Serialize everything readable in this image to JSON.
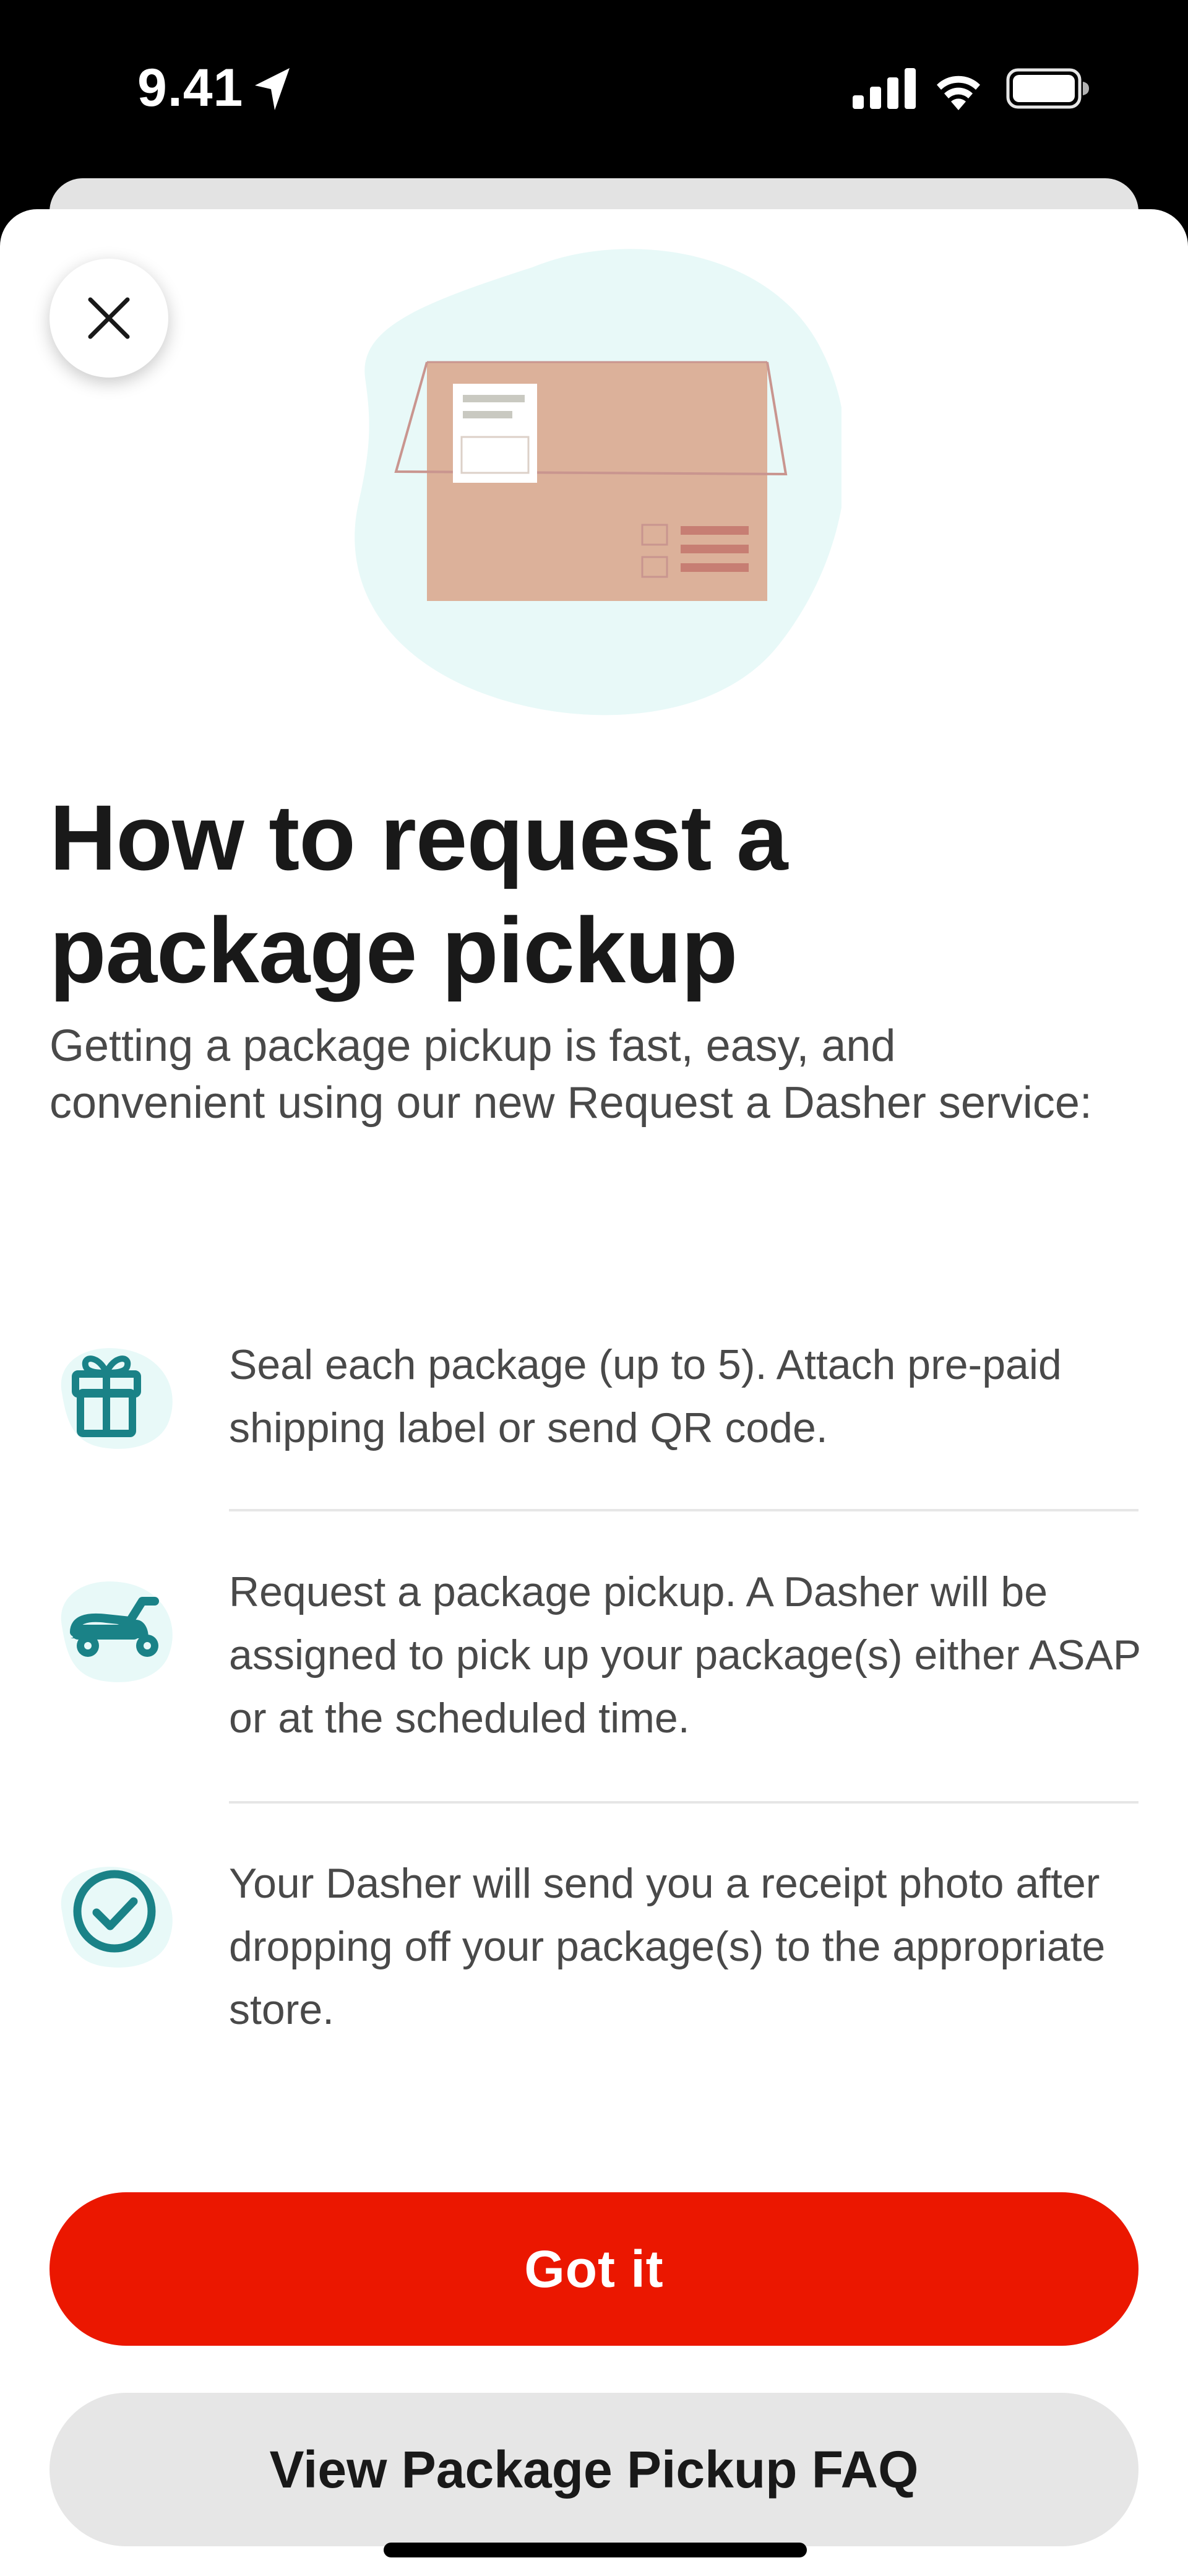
{
  "status_bar": {
    "time": "9.41",
    "icons": [
      "location-arrow-icon",
      "cellular-signal-icon",
      "wifi-icon",
      "battery-icon"
    ]
  },
  "modal": {
    "close_icon": "close-icon",
    "hero_illustration": "package-box-illustration",
    "title": "How to request a package pickup",
    "subtitle": "Getting a package pickup is fast, easy, and convenient using our new Request a Dasher service:",
    "steps": [
      {
        "icon": "gift-icon",
        "text": "Seal each package (up to 5). Attach pre-paid shipping label or send QR code."
      },
      {
        "icon": "scooter-icon",
        "text": "Request a package pickup. A Dasher will be assigned to pick up your package(s) either ASAP or at the scheduled time."
      },
      {
        "icon": "check-circle-icon",
        "text": "Your Dasher will send you a receipt photo after dropping off your package(s) to the appropriate store."
      }
    ],
    "primary_button": "Got it",
    "secondary_button": "View Package Pickup FAQ"
  },
  "colors": {
    "primary_red": "#eb1700",
    "teal_icon": "#1a8287",
    "icon_blob": "#e8f9f8",
    "box_color": "#dcb19a",
    "secondary_button_bg": "#e6e6e6",
    "title_text": "#191919",
    "body_text": "#494949"
  }
}
